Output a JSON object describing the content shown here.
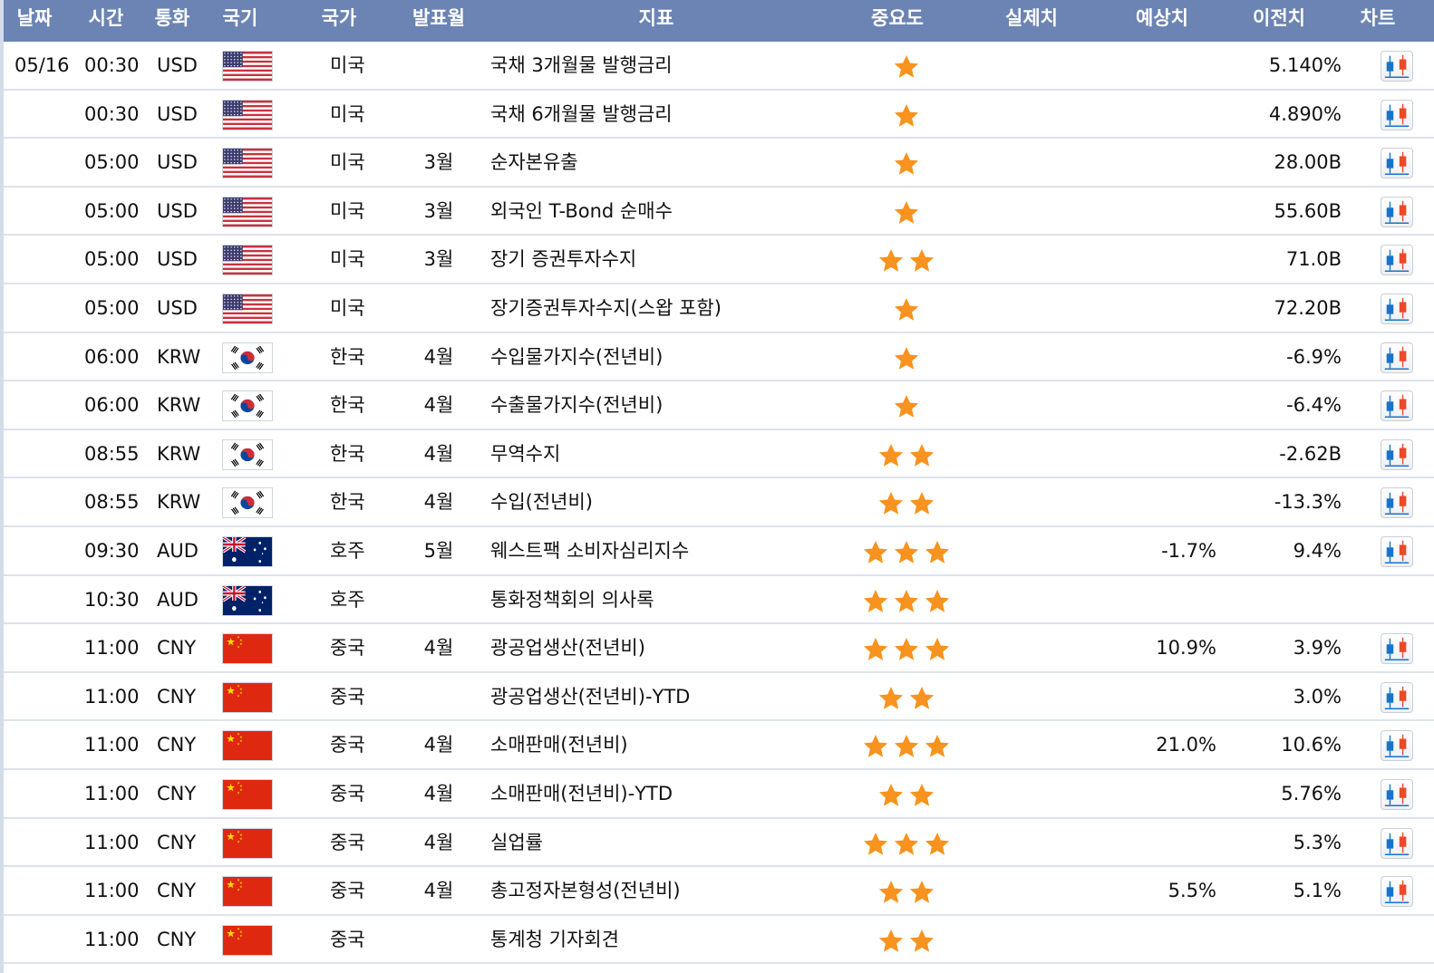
{
  "header": {
    "date": "날짜",
    "time": "시간",
    "currency": "통화",
    "flag": "국기",
    "country": "국가",
    "release_month": "발표월",
    "indicator": "지표",
    "importance": "중요도",
    "actual": "실제치",
    "forecast": "예상치",
    "previous": "이전치",
    "chart": "차트"
  },
  "colors": {
    "header_bg": "#6b84b3",
    "star": "#f7931e",
    "row_divider": "#dde3ec"
  },
  "flag_icons": {
    "USD": "us-flag-icon",
    "KRW": "kr-flag-icon",
    "AUD": "au-flag-icon",
    "CNY": "cn-flag-icon"
  },
  "rows": [
    {
      "date": "05/16",
      "time": "00:30",
      "currency": "USD",
      "country": "미국",
      "month": "",
      "indicator": "국채 3개월물 발행금리",
      "stars": 1,
      "actual": "",
      "forecast": "",
      "previous": "5.140%",
      "chart": true
    },
    {
      "date": "",
      "time": "00:30",
      "currency": "USD",
      "country": "미국",
      "month": "",
      "indicator": "국채 6개월물 발행금리",
      "stars": 1,
      "actual": "",
      "forecast": "",
      "previous": "4.890%",
      "chart": true
    },
    {
      "date": "",
      "time": "05:00",
      "currency": "USD",
      "country": "미국",
      "month": "3월",
      "indicator": "순자본유출",
      "stars": 1,
      "actual": "",
      "forecast": "",
      "previous": "28.00B",
      "chart": true
    },
    {
      "date": "",
      "time": "05:00",
      "currency": "USD",
      "country": "미국",
      "month": "3월",
      "indicator": "외국인 T-Bond 순매수",
      "stars": 1,
      "actual": "",
      "forecast": "",
      "previous": "55.60B",
      "chart": true
    },
    {
      "date": "",
      "time": "05:00",
      "currency": "USD",
      "country": "미국",
      "month": "3월",
      "indicator": "장기 증권투자수지",
      "stars": 2,
      "actual": "",
      "forecast": "",
      "previous": "71.0B",
      "chart": true
    },
    {
      "date": "",
      "time": "05:00",
      "currency": "USD",
      "country": "미국",
      "month": "",
      "indicator": "장기증권투자수지(스왑 포함)",
      "stars": 1,
      "actual": "",
      "forecast": "",
      "previous": "72.20B",
      "chart": true
    },
    {
      "date": "",
      "time": "06:00",
      "currency": "KRW",
      "country": "한국",
      "month": "4월",
      "indicator": "수입물가지수(전년비)",
      "stars": 1,
      "actual": "",
      "forecast": "",
      "previous": "-6.9%",
      "chart": true
    },
    {
      "date": "",
      "time": "06:00",
      "currency": "KRW",
      "country": "한국",
      "month": "4월",
      "indicator": "수출물가지수(전년비)",
      "stars": 1,
      "actual": "",
      "forecast": "",
      "previous": "-6.4%",
      "chart": true
    },
    {
      "date": "",
      "time": "08:55",
      "currency": "KRW",
      "country": "한국",
      "month": "4월",
      "indicator": "무역수지",
      "stars": 2,
      "actual": "",
      "forecast": "",
      "previous": "-2.62B",
      "chart": true
    },
    {
      "date": "",
      "time": "08:55",
      "currency": "KRW",
      "country": "한국",
      "month": "4월",
      "indicator": "수입(전년비)",
      "stars": 2,
      "actual": "",
      "forecast": "",
      "previous": "-13.3%",
      "chart": true
    },
    {
      "date": "",
      "time": "09:30",
      "currency": "AUD",
      "country": "호주",
      "month": "5월",
      "indicator": "웨스트팩 소비자심리지수",
      "stars": 3,
      "actual": "",
      "forecast": "-1.7%",
      "previous": "9.4%",
      "chart": true
    },
    {
      "date": "",
      "time": "10:30",
      "currency": "AUD",
      "country": "호주",
      "month": "",
      "indicator": "통화정책회의 의사록",
      "stars": 3,
      "actual": "",
      "forecast": "",
      "previous": "",
      "chart": false
    },
    {
      "date": "",
      "time": "11:00",
      "currency": "CNY",
      "country": "중국",
      "month": "4월",
      "indicator": "광공업생산(전년비)",
      "stars": 3,
      "actual": "",
      "forecast": "10.9%",
      "previous": "3.9%",
      "chart": true
    },
    {
      "date": "",
      "time": "11:00",
      "currency": "CNY",
      "country": "중국",
      "month": "",
      "indicator": "광공업생산(전년비)-YTD",
      "stars": 2,
      "actual": "",
      "forecast": "",
      "previous": "3.0%",
      "chart": true
    },
    {
      "date": "",
      "time": "11:00",
      "currency": "CNY",
      "country": "중국",
      "month": "4월",
      "indicator": "소매판매(전년비)",
      "stars": 3,
      "actual": "",
      "forecast": "21.0%",
      "previous": "10.6%",
      "chart": true
    },
    {
      "date": "",
      "time": "11:00",
      "currency": "CNY",
      "country": "중국",
      "month": "4월",
      "indicator": "소매판매(전년비)-YTD",
      "stars": 2,
      "actual": "",
      "forecast": "",
      "previous": "5.76%",
      "chart": true
    },
    {
      "date": "",
      "time": "11:00",
      "currency": "CNY",
      "country": "중국",
      "month": "4월",
      "indicator": "실업률",
      "stars": 3,
      "actual": "",
      "forecast": "",
      "previous": "5.3%",
      "chart": true
    },
    {
      "date": "",
      "time": "11:00",
      "currency": "CNY",
      "country": "중국",
      "month": "4월",
      "indicator": "총고정자본형성(전년비)",
      "stars": 2,
      "actual": "",
      "forecast": "5.5%",
      "previous": "5.1%",
      "chart": true
    },
    {
      "date": "",
      "time": "11:00",
      "currency": "CNY",
      "country": "중국",
      "month": "",
      "indicator": "통계청 기자회견",
      "stars": 2,
      "actual": "",
      "forecast": "",
      "previous": "",
      "chart": false
    }
  ]
}
